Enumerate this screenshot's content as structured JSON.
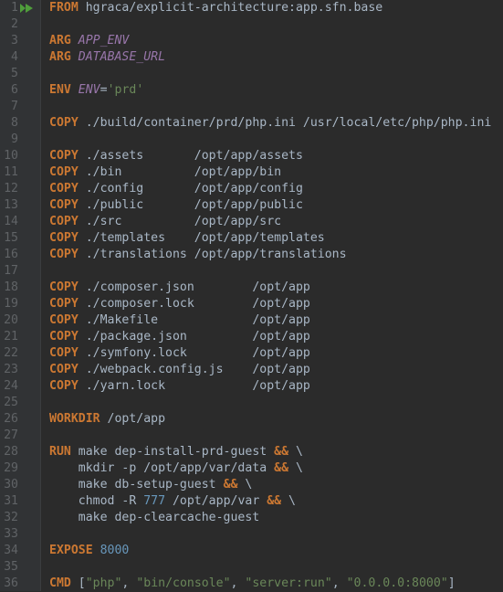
{
  "editor": {
    "colors": {
      "background": "#2b2b2b",
      "gutter": "#313335",
      "keyword": "#cc7832",
      "variable": "#9876aa",
      "string": "#6a8759",
      "number": "#6897bb",
      "text": "#a9b7c6",
      "line_number": "#606366"
    },
    "run_icon": "run-icon",
    "lines": [
      {
        "n": "1",
        "tokens": [
          {
            "t": "kw",
            "v": "FROM"
          },
          {
            "t": "plain",
            "v": " hgraca/explicit-architecture:app.sfn.base"
          }
        ]
      },
      {
        "n": "2",
        "tokens": []
      },
      {
        "n": "3",
        "tokens": [
          {
            "t": "kw",
            "v": "ARG"
          },
          {
            "t": "plain",
            "v": " "
          },
          {
            "t": "var",
            "v": "APP_ENV"
          }
        ]
      },
      {
        "n": "4",
        "tokens": [
          {
            "t": "kw",
            "v": "ARG"
          },
          {
            "t": "plain",
            "v": " "
          },
          {
            "t": "var",
            "v": "DATABASE_URL"
          }
        ]
      },
      {
        "n": "5",
        "tokens": []
      },
      {
        "n": "6",
        "tokens": [
          {
            "t": "kw",
            "v": "ENV"
          },
          {
            "t": "plain",
            "v": " "
          },
          {
            "t": "var",
            "v": "ENV"
          },
          {
            "t": "plain",
            "v": "="
          },
          {
            "t": "str",
            "v": "'prd'"
          }
        ]
      },
      {
        "n": "7",
        "tokens": []
      },
      {
        "n": "8",
        "tokens": [
          {
            "t": "kw",
            "v": "COPY"
          },
          {
            "t": "plain",
            "v": " ./build/container/prd/php.ini /usr/local/etc/php/php.ini"
          }
        ]
      },
      {
        "n": "9",
        "tokens": []
      },
      {
        "n": "10",
        "tokens": [
          {
            "t": "kw",
            "v": "COPY"
          },
          {
            "t": "plain",
            "v": " ./assets       /opt/app/assets"
          }
        ]
      },
      {
        "n": "11",
        "tokens": [
          {
            "t": "kw",
            "v": "COPY"
          },
          {
            "t": "plain",
            "v": " ./bin          /opt/app/bin"
          }
        ]
      },
      {
        "n": "12",
        "tokens": [
          {
            "t": "kw",
            "v": "COPY"
          },
          {
            "t": "plain",
            "v": " ./config       /opt/app/config"
          }
        ]
      },
      {
        "n": "13",
        "tokens": [
          {
            "t": "kw",
            "v": "COPY"
          },
          {
            "t": "plain",
            "v": " ./public       /opt/app/public"
          }
        ]
      },
      {
        "n": "14",
        "tokens": [
          {
            "t": "kw",
            "v": "COPY"
          },
          {
            "t": "plain",
            "v": " ./src          /opt/app/src"
          }
        ]
      },
      {
        "n": "15",
        "tokens": [
          {
            "t": "kw",
            "v": "COPY"
          },
          {
            "t": "plain",
            "v": " ./templates    /opt/app/templates"
          }
        ]
      },
      {
        "n": "16",
        "tokens": [
          {
            "t": "kw",
            "v": "COPY"
          },
          {
            "t": "plain",
            "v": " ./translations /opt/app/translations"
          }
        ]
      },
      {
        "n": "17",
        "tokens": []
      },
      {
        "n": "18",
        "tokens": [
          {
            "t": "kw",
            "v": "COPY"
          },
          {
            "t": "plain",
            "v": " ./composer.json        /opt/app"
          }
        ]
      },
      {
        "n": "19",
        "tokens": [
          {
            "t": "kw",
            "v": "COPY"
          },
          {
            "t": "plain",
            "v": " ./composer.lock        /opt/app"
          }
        ]
      },
      {
        "n": "20",
        "tokens": [
          {
            "t": "kw",
            "v": "COPY"
          },
          {
            "t": "plain",
            "v": " ./Makefile             /opt/app"
          }
        ]
      },
      {
        "n": "21",
        "tokens": [
          {
            "t": "kw",
            "v": "COPY"
          },
          {
            "t": "plain",
            "v": " ./package.json         /opt/app"
          }
        ]
      },
      {
        "n": "22",
        "tokens": [
          {
            "t": "kw",
            "v": "COPY"
          },
          {
            "t": "plain",
            "v": " ./symfony.lock         /opt/app"
          }
        ]
      },
      {
        "n": "23",
        "tokens": [
          {
            "t": "kw",
            "v": "COPY"
          },
          {
            "t": "plain",
            "v": " ./webpack.config.js    /opt/app"
          }
        ]
      },
      {
        "n": "24",
        "tokens": [
          {
            "t": "kw",
            "v": "COPY"
          },
          {
            "t": "plain",
            "v": " ./yarn.lock            /opt/app"
          }
        ]
      },
      {
        "n": "25",
        "tokens": []
      },
      {
        "n": "26",
        "tokens": [
          {
            "t": "kw",
            "v": "WORKDIR"
          },
          {
            "t": "plain",
            "v": " /opt/app"
          }
        ]
      },
      {
        "n": "27",
        "tokens": []
      },
      {
        "n": "28",
        "tokens": [
          {
            "t": "kw",
            "v": "RUN"
          },
          {
            "t": "plain",
            "v": " make dep-install-prd-guest "
          },
          {
            "t": "kw",
            "v": "&&"
          },
          {
            "t": "plain",
            "v": " \\"
          }
        ]
      },
      {
        "n": "29",
        "tokens": [
          {
            "t": "plain",
            "v": "    mkdir -p /opt/app/var/data "
          },
          {
            "t": "kw",
            "v": "&&"
          },
          {
            "t": "plain",
            "v": " \\"
          }
        ]
      },
      {
        "n": "30",
        "tokens": [
          {
            "t": "plain",
            "v": "    make db-setup-guest "
          },
          {
            "t": "kw",
            "v": "&&"
          },
          {
            "t": "plain",
            "v": " \\"
          }
        ]
      },
      {
        "n": "31",
        "tokens": [
          {
            "t": "plain",
            "v": "    chmod -R "
          },
          {
            "t": "num",
            "v": "777"
          },
          {
            "t": "plain",
            "v": " /opt/app/var "
          },
          {
            "t": "kw",
            "v": "&&"
          },
          {
            "t": "plain",
            "v": " \\"
          }
        ]
      },
      {
        "n": "32",
        "tokens": [
          {
            "t": "plain",
            "v": "    make dep-clearcache-guest"
          }
        ]
      },
      {
        "n": "33",
        "tokens": []
      },
      {
        "n": "34",
        "tokens": [
          {
            "t": "kw",
            "v": "EXPOSE"
          },
          {
            "t": "plain",
            "v": " "
          },
          {
            "t": "num",
            "v": "8000"
          }
        ]
      },
      {
        "n": "35",
        "tokens": []
      },
      {
        "n": "36",
        "tokens": [
          {
            "t": "kw",
            "v": "CMD"
          },
          {
            "t": "plain",
            "v": " ["
          },
          {
            "t": "str",
            "v": "\"php\""
          },
          {
            "t": "plain",
            "v": ", "
          },
          {
            "t": "str",
            "v": "\"bin/console\""
          },
          {
            "t": "plain",
            "v": ", "
          },
          {
            "t": "str",
            "v": "\"server:run\""
          },
          {
            "t": "plain",
            "v": ", "
          },
          {
            "t": "str",
            "v": "\"0.0.0.0:8000\""
          },
          {
            "t": "plain",
            "v": "]"
          }
        ]
      }
    ]
  }
}
